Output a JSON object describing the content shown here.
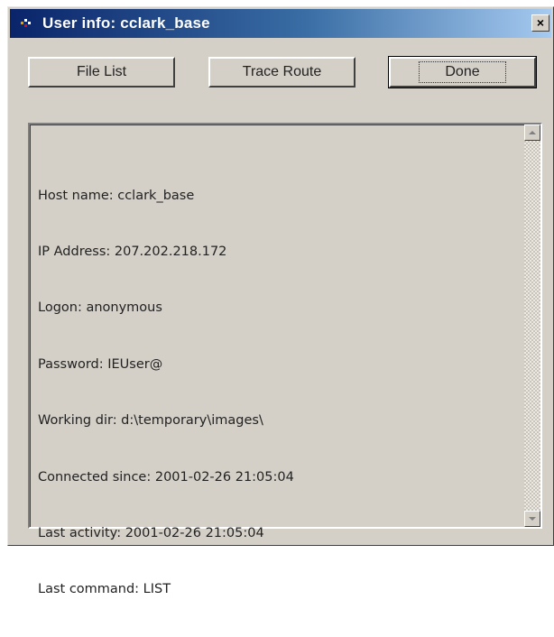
{
  "window": {
    "title": "User info: cclark_base",
    "close_glyph": "×"
  },
  "buttons": {
    "file_list": "File List",
    "trace_route": "Trace Route",
    "done": "Done"
  },
  "info": {
    "lines": [
      "Host name: cclark_base",
      "IP Address: 207.202.218.172",
      "Logon: anonymous",
      "Password: IEUser@",
      "Working dir: d:\\temporary\\images\\",
      "Connected since: 2001-02-26 21:05:04",
      "Last activity: 2001-02-26 21:05:04",
      "Last command: LIST"
    ]
  },
  "colors": {
    "titlebar_start": "#0a246a",
    "titlebar_end": "#a6caf0",
    "window_face": "#d4d0c8"
  },
  "icons": {
    "app": "app-icon",
    "close": "close-icon",
    "scroll_up": "arrow-up-icon",
    "scroll_down": "arrow-down-icon"
  }
}
